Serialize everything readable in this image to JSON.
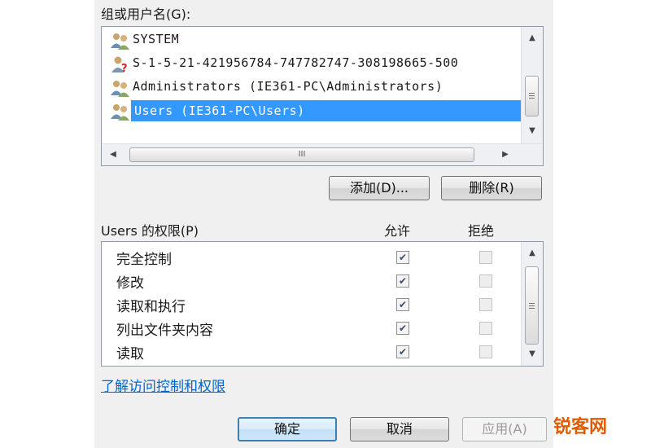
{
  "group_label": "组或用户名(G):",
  "users": [
    {
      "name": "SYSTEM",
      "icon": "users-icon"
    },
    {
      "name": "S-1-5-21-421956784-747782747-308198665-500",
      "icon": "unknown-user-icon"
    },
    {
      "name": "Administrators (IE361-PC\\Administrators)",
      "icon": "users-icon"
    },
    {
      "name": "Users (IE361-PC\\Users)",
      "icon": "users-icon",
      "selected": true
    }
  ],
  "scroll_grip": "III",
  "buttons": {
    "add": "添加(D)...",
    "remove": "删除(R)",
    "ok": "确定",
    "cancel": "取消",
    "apply": "应用(A)"
  },
  "perm_label": "Users 的权限(P)",
  "col_allow": "允许",
  "col_deny": "拒绝",
  "permissions": [
    {
      "name": "完全控制",
      "allow": true,
      "deny": false
    },
    {
      "name": "修改",
      "allow": true,
      "deny": false
    },
    {
      "name": "读取和执行",
      "allow": true,
      "deny": false
    },
    {
      "name": "列出文件夹内容",
      "allow": true,
      "deny": false
    },
    {
      "name": "读取",
      "allow": true,
      "deny": false
    }
  ],
  "link_text": "了解访问控制和权限",
  "watermark": "锐客网",
  "colors": {
    "selection": "#3399ff",
    "link": "#0066cc",
    "watermark": "#e05a00"
  }
}
